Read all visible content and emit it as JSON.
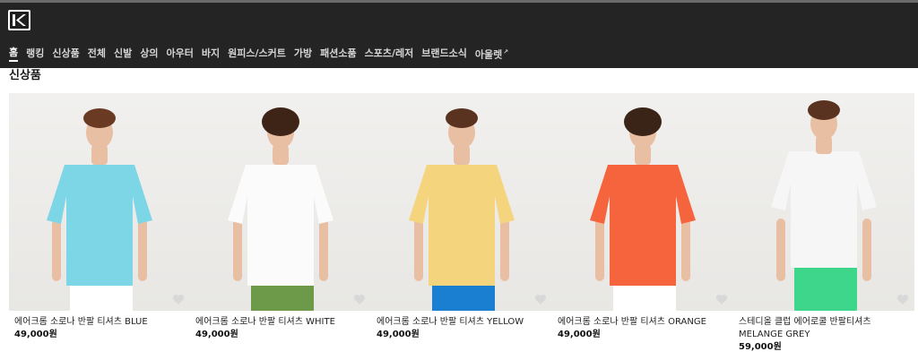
{
  "header": {
    "logo_icon": "kodak-k-logo-icon",
    "nav": [
      {
        "label": "홈",
        "active": true
      },
      {
        "label": "랭킹"
      },
      {
        "label": "신상품"
      },
      {
        "label": "전체"
      },
      {
        "label": "신발"
      },
      {
        "label": "상의"
      },
      {
        "label": "아우터"
      },
      {
        "label": "바지"
      },
      {
        "label": "원피스/스커트"
      },
      {
        "label": "가방"
      },
      {
        "label": "패션소품"
      },
      {
        "label": "스포츠/레저"
      },
      {
        "label": "브랜드소식"
      },
      {
        "label": "아울렛",
        "external_mark": "↗"
      }
    ]
  },
  "section": {
    "title": "신상품"
  },
  "products": [
    {
      "name": "에어크롬 소로나 반팔 티셔츠 BLUE",
      "price": "49,000원",
      "shirt_color": "#7dd6e6",
      "bottom_color": "#ffffff",
      "hair_color": "#6b3a22"
    },
    {
      "name": "에어크롬 소로나 반팔 티셔츠 WHITE",
      "price": "49,000원",
      "shirt_color": "#fbfbfb",
      "bottom_color": "#6c9a48",
      "hair_color": "#3e2416"
    },
    {
      "name": "에어크롬 소로나 반팔 티셔츠 YELLOW",
      "price": "49,000원",
      "shirt_color": "#f5d47e",
      "bottom_color": "#1a7fd0",
      "hair_color": "#5a3320"
    },
    {
      "name": "에어크롬 소로나 반팔 티셔츠 ORANGE",
      "price": "49,000원",
      "shirt_color": "#f5643c",
      "bottom_color": "#ffffff",
      "hair_color": "#3a2418"
    },
    {
      "name": "스테디올 클럽 에어로쿨 반팔티셔츠 MELANGE GREY",
      "price": "59,000원",
      "shirt_color": "#f6f6f6",
      "bottom_color": "#3dd68a",
      "hair_color": "#5a3320"
    }
  ],
  "colors": {
    "header_bg": "#242424",
    "page_bg": "#ffffff"
  },
  "icons": {
    "wishlist": "heart-icon"
  }
}
